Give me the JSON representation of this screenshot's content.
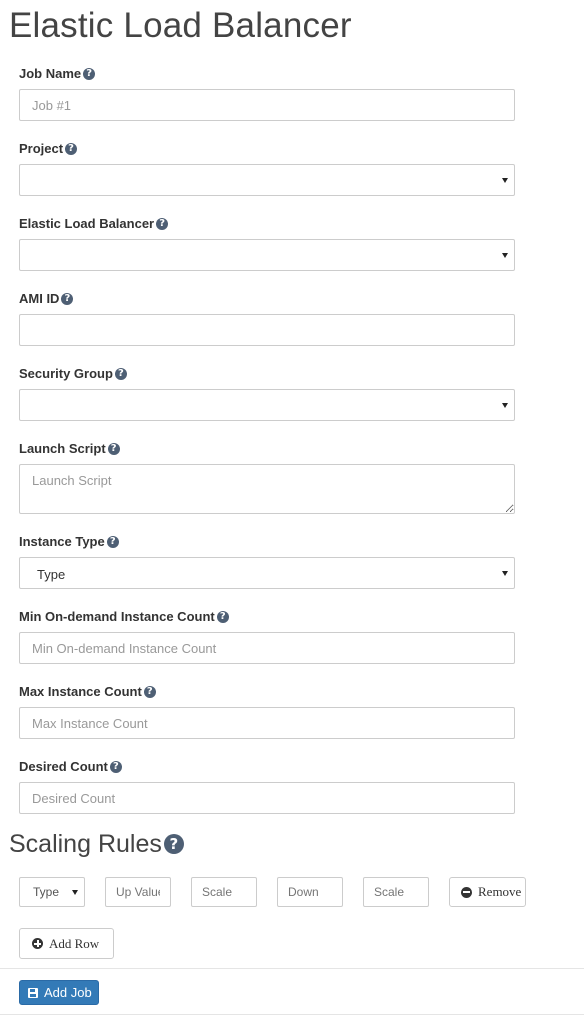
{
  "page": {
    "title": "Elastic Load Balancer"
  },
  "help_glyph": "?",
  "fields": {
    "job_name": {
      "label": "Job Name",
      "placeholder": "Job #1",
      "value": ""
    },
    "project": {
      "label": "Project",
      "value": ""
    },
    "elb": {
      "label": "Elastic Load Balancer",
      "value": ""
    },
    "ami_id": {
      "label": "AMI ID",
      "value": ""
    },
    "security_group": {
      "label": "Security Group",
      "value": ""
    },
    "launch_script": {
      "label": "Launch Script",
      "placeholder": "Launch Script"
    },
    "instance_type": {
      "label": "Instance Type",
      "value": "Type"
    },
    "min_ondemand": {
      "label": "Min On-demand Instance Count",
      "placeholder": "Min On-demand Instance Count"
    },
    "max_instance": {
      "label": "Max Instance Count",
      "placeholder": "Max Instance Count"
    },
    "desired_count": {
      "label": "Desired Count",
      "placeholder": "Desired Count"
    }
  },
  "scaling": {
    "title": "Scaling Rules",
    "row": {
      "type_value": "Type",
      "up_placeholder": "Up Value",
      "scale_up_placeholder": "Scale",
      "down_placeholder": "Down",
      "scale_down_placeholder": "Scale",
      "remove_label": "Remove"
    },
    "add_row_label": "Add Row"
  },
  "footer": {
    "add_job_label": "Add Job"
  },
  "icons": {
    "help": "question-circle-icon",
    "caret": "caret-down-icon",
    "remove": "minus-circle-icon",
    "add": "plus-circle-icon",
    "save": "floppy-disk-icon"
  },
  "colors": {
    "primary": "#337ab7",
    "border": "#cccccc",
    "help_icon": "#4e5f74"
  }
}
